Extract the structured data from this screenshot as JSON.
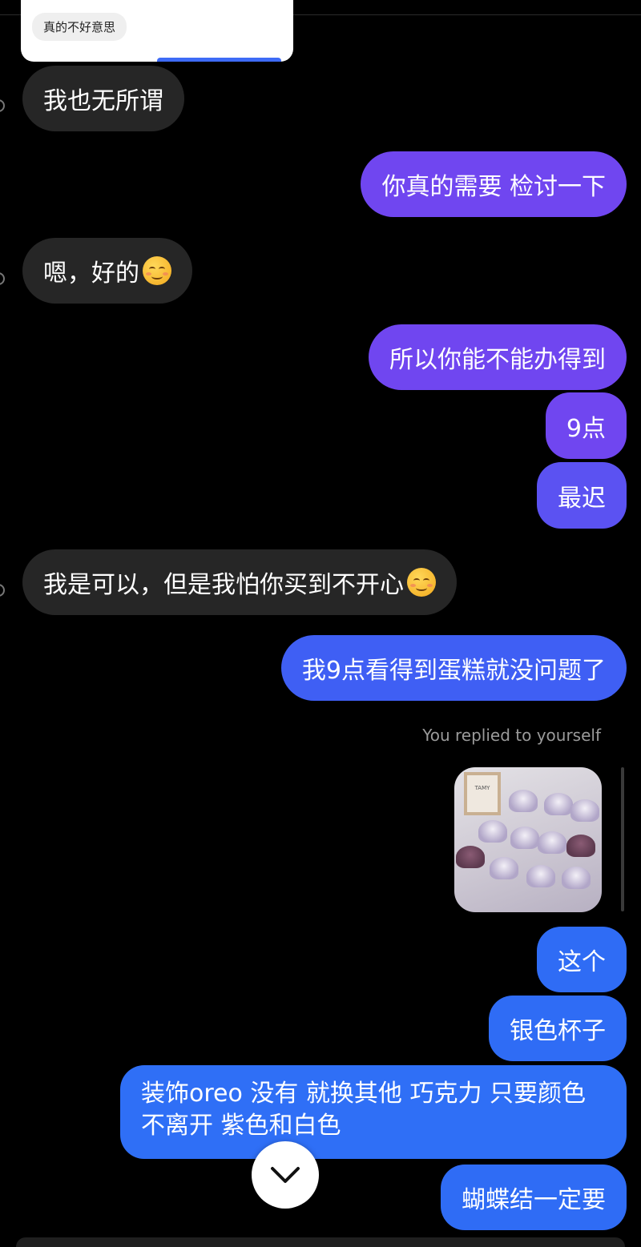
{
  "quoted_message": {
    "text": "真的不好意思"
  },
  "messages": [
    {
      "from": "them",
      "text": "我也无所谓"
    },
    {
      "from": "me",
      "text": "你真的需要 检讨一下"
    },
    {
      "from": "them",
      "text": "嗯，好的",
      "emoji": "smiling-face-icon"
    },
    {
      "from": "me",
      "text": "所以你能不能办得到"
    },
    {
      "from": "me",
      "text": "9点"
    },
    {
      "from": "me",
      "text": "最迟"
    },
    {
      "from": "them",
      "text": "我是可以，但是我怕你买到不开心",
      "emoji": "smiling-face-icon"
    },
    {
      "from": "me",
      "text": "我9点看得到蛋糕就没问题了"
    },
    {
      "from": "me",
      "text": "这个"
    },
    {
      "from": "me",
      "text": "银色杯子"
    },
    {
      "from": "me",
      "text": "装饰oreo 没有 就换其他 巧克力 只要颜色不离开 紫色和白色"
    },
    {
      "from": "me",
      "text": "蝴蝶结一定要"
    }
  ],
  "reply_note": "You replied to yourself",
  "shared_photo": {
    "frame_text": "TAMY"
  },
  "colors": {
    "background": "#000000",
    "incoming_bubble": "#262626",
    "outgoing_purple": "#7046f0",
    "outgoing_blue": "#2f6ff6"
  }
}
